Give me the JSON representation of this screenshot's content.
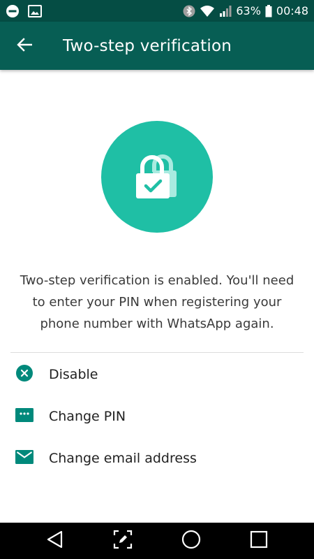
{
  "status_bar": {
    "battery_percent": "63%",
    "time": "00:48",
    "icons": [
      "do-not-disturb-icon",
      "image-notification-icon",
      "bluetooth-icon",
      "wifi-icon",
      "signal-icon",
      "battery-icon"
    ]
  },
  "app_bar": {
    "title": "Two-step verification",
    "back_icon": "arrow-back-icon",
    "background": "#075e54"
  },
  "hero": {
    "icon": "lock-check-icon",
    "color": "#1fbfa5"
  },
  "description": "Two-step verification is enabled. You'll need to enter your PIN when registering your phone number with WhatsApp again.",
  "options": [
    {
      "label": "Disable",
      "icon": "disable-x-icon"
    },
    {
      "label": "Change PIN",
      "icon": "pin-icon"
    },
    {
      "label": "Change email address",
      "icon": "email-icon"
    }
  ],
  "accent_color": "#00897b",
  "nav_bar": {
    "buttons": [
      "back-triangle-icon",
      "edit-screenshot-icon",
      "home-circle-icon",
      "recents-square-icon"
    ]
  }
}
